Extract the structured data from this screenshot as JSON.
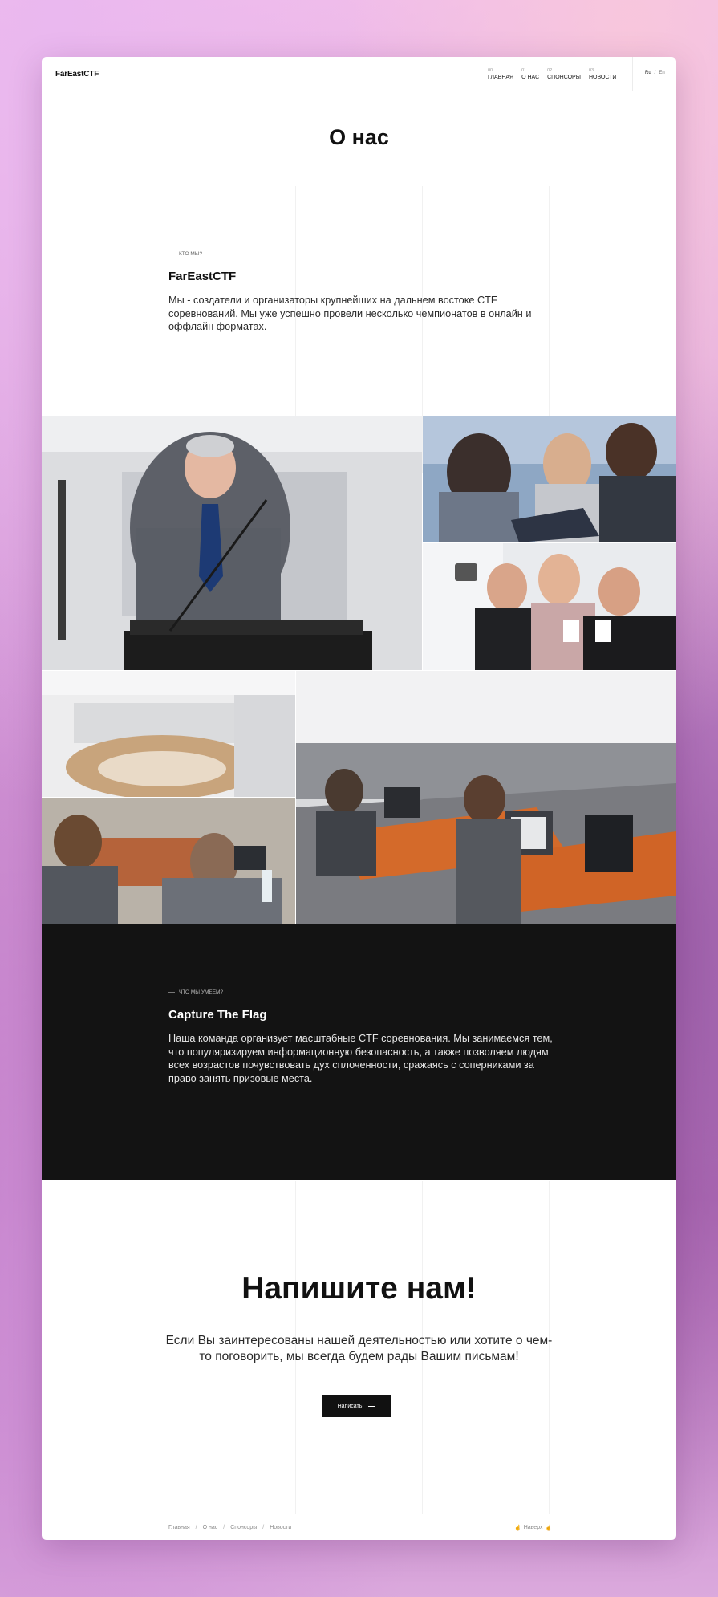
{
  "header": {
    "logo": "FarEastCTF",
    "nav": [
      {
        "num": "00",
        "label": "Главная"
      },
      {
        "num": "01",
        "label": "О нас"
      },
      {
        "num": "02",
        "label": "Спонсоры"
      },
      {
        "num": "03",
        "label": "Новости"
      }
    ],
    "lang": {
      "ru": "Ru",
      "sep": "/",
      "en": "En"
    }
  },
  "page_title": "О нас",
  "about": {
    "eyebrow": "Кто мы?",
    "heading": "FarEastCTF",
    "text": "Мы - создатели и организаторы крупнейших на дальнем востоке CTF соревнований. Мы уже успешно провели несколько чемпионатов в онлайн и оффлайн форматах."
  },
  "what": {
    "eyebrow": "Что мы умеем?",
    "heading": "Capture The Flag",
    "text": "Наша команда организует масштабные CTF соревнования. Мы занимаемся тем, что популяризируем информационную безопасность, а также позволяем людям всех возрастов почувствовать дух сплоченности, сражаясь с соперниками за право занять призовые места."
  },
  "contact": {
    "title": "Напишите нам!",
    "text": "Если Вы заинтересованы нашей деятельностью или хотите о чем-то поговорить, мы всегда будем рады Вашим письмам!",
    "button": "Написать"
  },
  "footer": {
    "crumbs": [
      "Главная",
      "О нас",
      "Спонсоры",
      "Новости"
    ],
    "crumb_sep": "/",
    "up": "Наверх"
  }
}
